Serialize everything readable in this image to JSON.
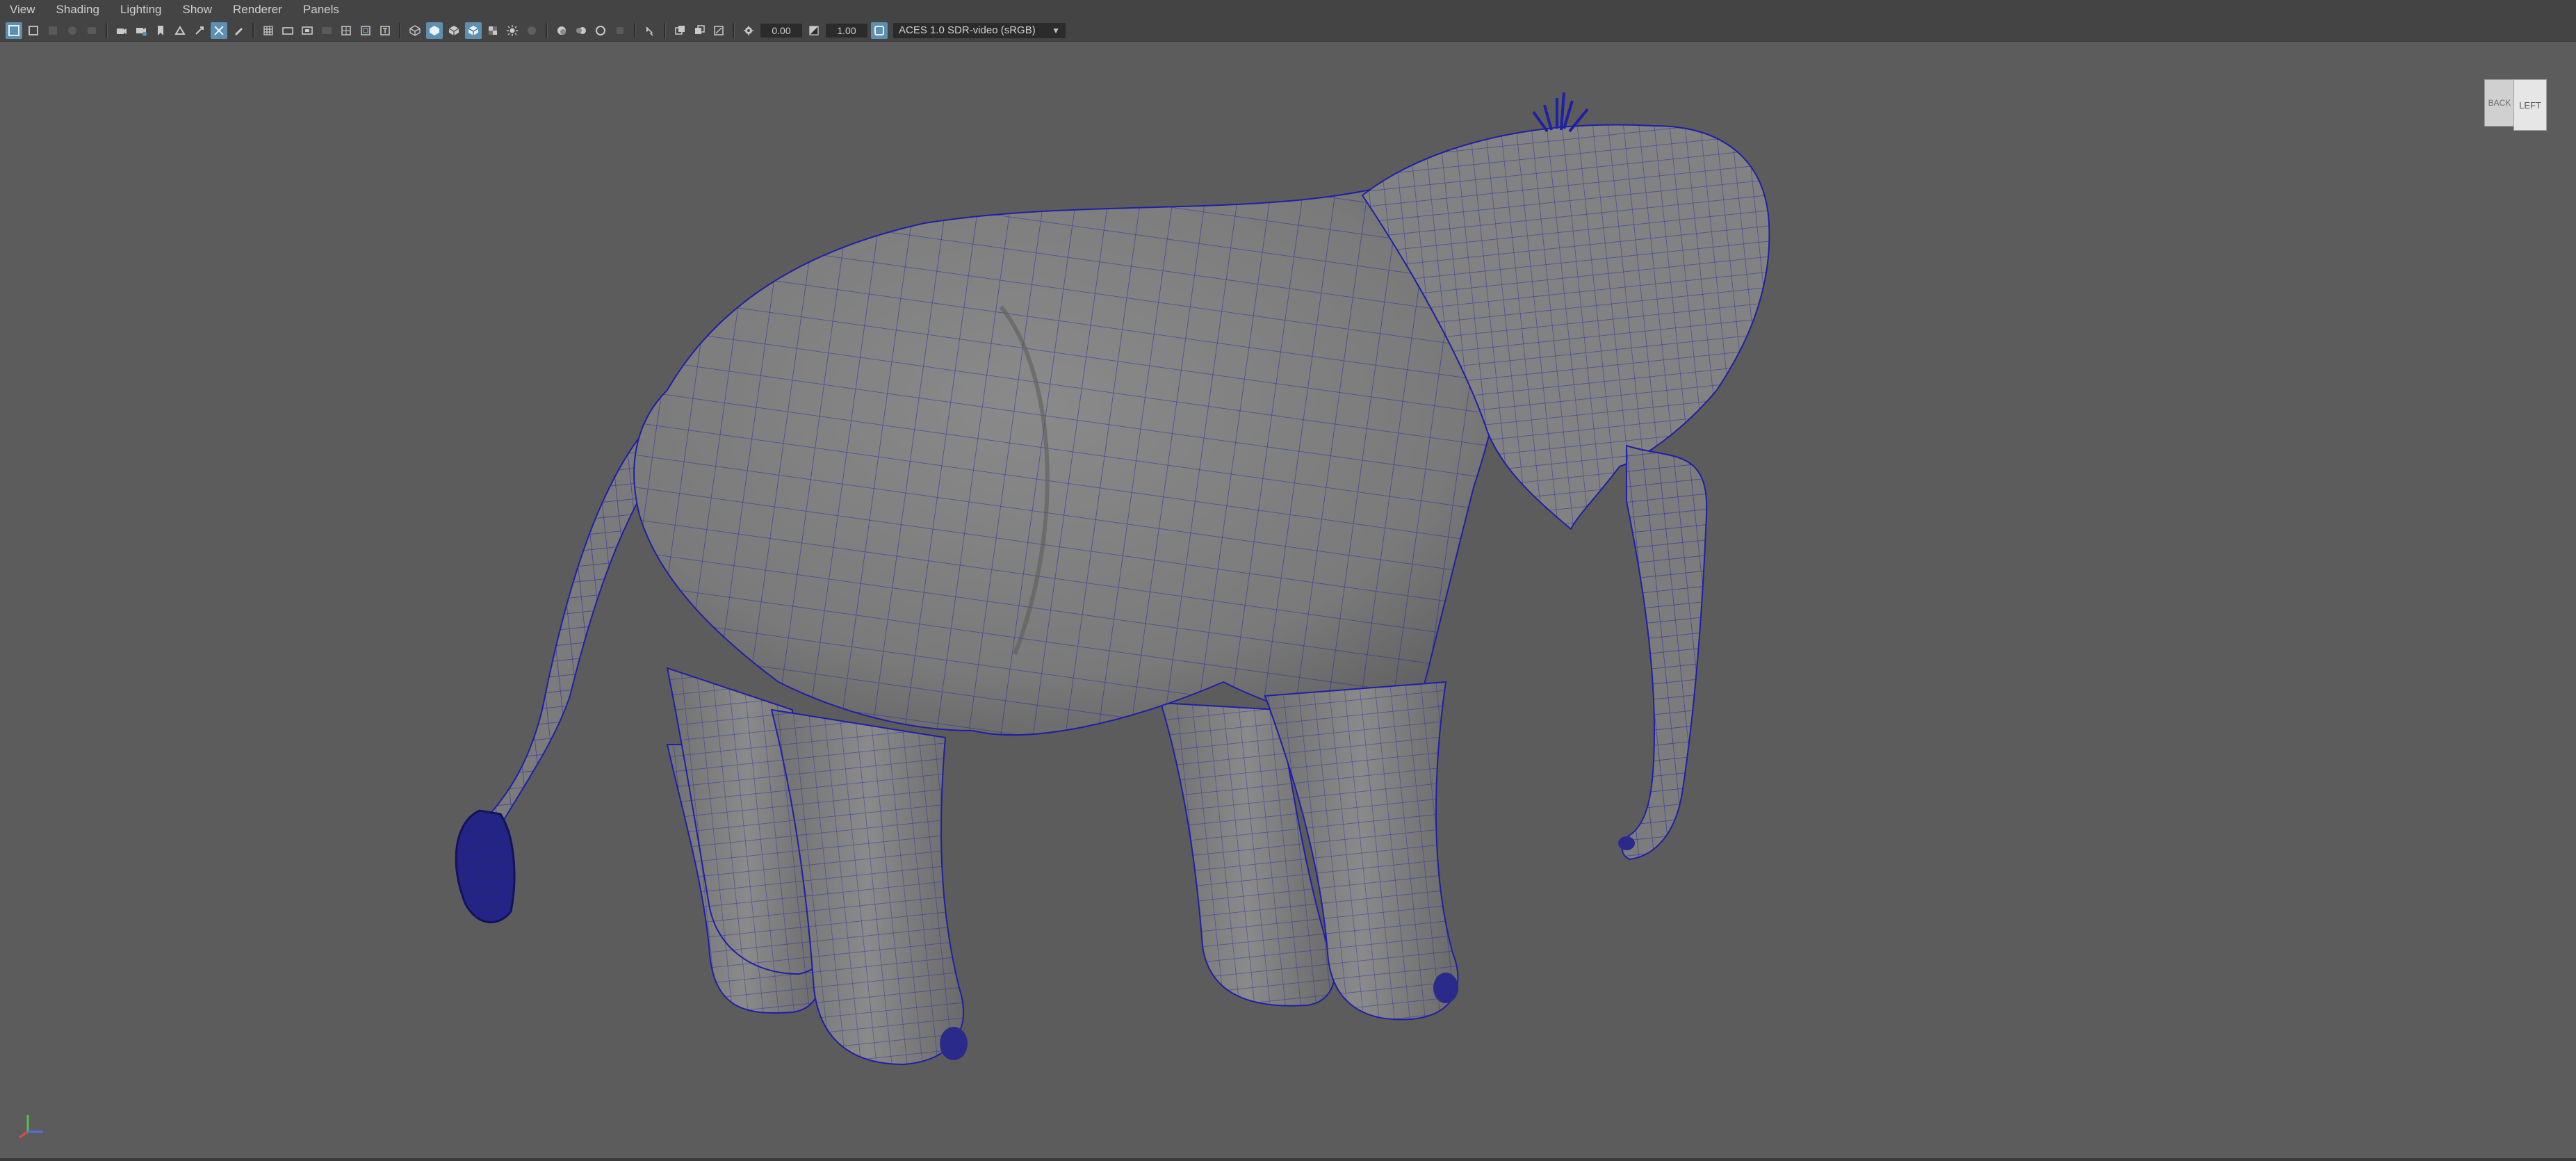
{
  "menu": {
    "items": [
      "View",
      "Shading",
      "Lighting",
      "Show",
      "Renderer",
      "Panels"
    ]
  },
  "toolbar": {
    "exposure_value": "0.00",
    "gamma_value": "1.00",
    "colorspace_value": "ACES 1.0 SDR-video (sRGB)"
  },
  "viewcube": {
    "front_label": "LEFT",
    "side_label": "BACK"
  },
  "icons": {
    "toolbar": [
      "select-camera-icon",
      "camera-attributes-icon",
      "bookmark-icon",
      "image-plane-icon",
      "grid-icon",
      "film-gate-icon",
      "resolution-gate-icon",
      "wireframe-icon",
      "smooth-shade-icon",
      "textured-icon",
      "lights-icon",
      "shadows-icon",
      "isolate-icon",
      "xray-icon",
      "exposure-icon",
      "gamma-icon",
      "colorspace-icon"
    ]
  },
  "colors": {
    "viewport_bg": "#5c5c5c",
    "wire": "#1f1fa8",
    "mesh": "#7e7e7e",
    "active_button": "#5d8fb0"
  }
}
